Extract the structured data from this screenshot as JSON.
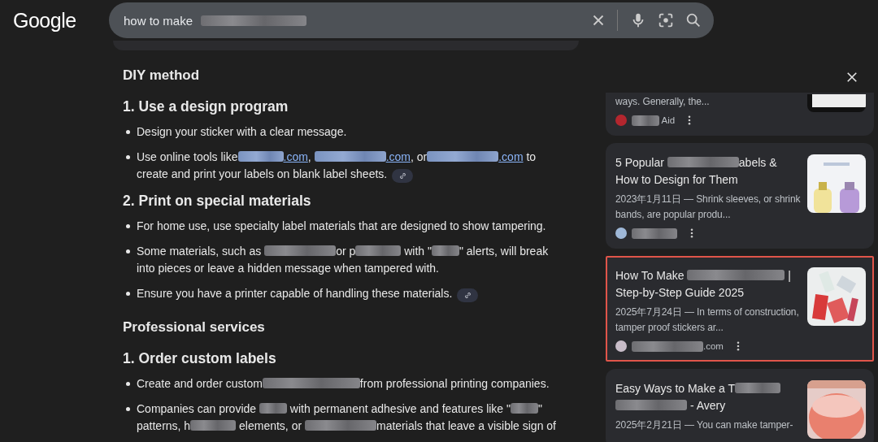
{
  "logo": "Google",
  "search": {
    "value": "how to make",
    "value_blurred": true
  },
  "sections": [
    {
      "kind": "section",
      "text": "DIY method"
    },
    {
      "kind": "step",
      "text": "1. Use a design program"
    },
    {
      "kind": "bullet",
      "source_link": false,
      "segments": [
        {
          "kind": "text",
          "text": "Design your sticker with a clear message."
        }
      ]
    },
    {
      "kind": "bullet",
      "source_link": true,
      "segments": [
        {
          "kind": "text",
          "text": "Use online tools like"
        },
        {
          "kind": "bluelink"
        },
        {
          "kind": "link",
          "text": ".com"
        },
        {
          "kind": "text",
          "text": ", "
        },
        {
          "kind": "longbluelink"
        },
        {
          "kind": "link",
          "text": ".com"
        },
        {
          "kind": "text",
          "text": ", or"
        },
        {
          "kind": "longbluelink"
        },
        {
          "kind": "link",
          "text": ".com"
        },
        {
          "kind": "text",
          "text": " to create and print your labels on blank label sheets."
        }
      ]
    },
    {
      "kind": "step",
      "text": "2. Print on special materials"
    },
    {
      "kind": "bullet",
      "source_link": false,
      "segments": [
        {
          "kind": "text",
          "text": "For home use, use specialty label materials that are designed to show tampering."
        }
      ]
    },
    {
      "kind": "bullet",
      "source_link": false,
      "segments": [
        {
          "kind": "text",
          "text": "Some materials, such as "
        },
        {
          "kind": "longblur"
        },
        {
          "kind": "text",
          "text": "or p"
        },
        {
          "kind": "blur"
        },
        {
          "kind": "text",
          "text": " with \""
        },
        {
          "kind": "shortblur"
        },
        {
          "kind": "text",
          "text": "\" alerts, will break into pieces or leave a hidden message when tampered with."
        }
      ]
    },
    {
      "kind": "bullet",
      "source_link": true,
      "segments": [
        {
          "kind": "text",
          "text": "Ensure you have a printer capable of handling these materials."
        }
      ]
    },
    {
      "kind": "section",
      "text": "Professional services"
    },
    {
      "kind": "step",
      "text": "1. Order custom labels"
    },
    {
      "kind": "bullet",
      "source_link": false,
      "segments": [
        {
          "kind": "text",
          "text": "Create and order custom"
        },
        {
          "kind": "wideblur"
        },
        {
          "kind": "text",
          "text": "from professional printing companies."
        }
      ]
    },
    {
      "kind": "bullet",
      "source_link": false,
      "segments": [
        {
          "kind": "text",
          "text": "Companies can provide "
        },
        {
          "kind": "shortblur"
        },
        {
          "kind": "text",
          "text": " with permanent adhesive and features like \""
        },
        {
          "kind": "shortblur"
        },
        {
          "kind": "text",
          "text": "\" patterns, h"
        },
        {
          "kind": "blur"
        },
        {
          "kind": "text",
          "text": " elements, or "
        },
        {
          "kind": "longblur"
        },
        {
          "kind": "text",
          "text": "materials that leave a visible sign of"
        }
      ]
    }
  ],
  "results": [
    {
      "highlighted": false,
      "cut_top": true,
      "snippet": "ways. Generally, the...",
      "color": "#b3262e",
      "source": [
        {
          "kind": "shortblur"
        },
        {
          "kind": "text",
          "text": " Aid"
        }
      ]
    },
    {
      "highlighted": false,
      "cut_top": false,
      "title": [
        {
          "kind": "text",
          "text": "5 Popular "
        },
        {
          "kind": "longblur"
        },
        {
          "kind": "text",
          "text": "abels & How to Design for Them"
        }
      ],
      "snippet": "2023年1月11日 — Shrink sleeves, or shrink bands, are popular produ...",
      "color": "#9fb8d8",
      "source": [
        {
          "kind": "blur"
        }
      ]
    },
    {
      "highlighted": true,
      "cut_top": false,
      "title": [
        {
          "kind": "text",
          "text": "How To Make "
        },
        {
          "kind": "wideblur"
        },
        {
          "kind": "text",
          "text": " | Step-by-Step Guide 2025"
        }
      ],
      "snippet": "2025年7月24日 — In terms of construction, tamper proof stickers ar...",
      "color": "#c8bcc8",
      "source": [
        {
          "kind": "longblur"
        },
        {
          "kind": "text",
          "text": ".com"
        }
      ]
    },
    {
      "highlighted": false,
      "cut_top": false,
      "title": [
        {
          "kind": "text",
          "text": "Easy Ways to Make a T"
        },
        {
          "kind": "blur"
        },
        {
          "kind": "longblur"
        },
        {
          "kind": "text",
          "text": " - Avery"
        }
      ],
      "snippet": "2025年2月21日 — You can make tamper-"
    }
  ]
}
